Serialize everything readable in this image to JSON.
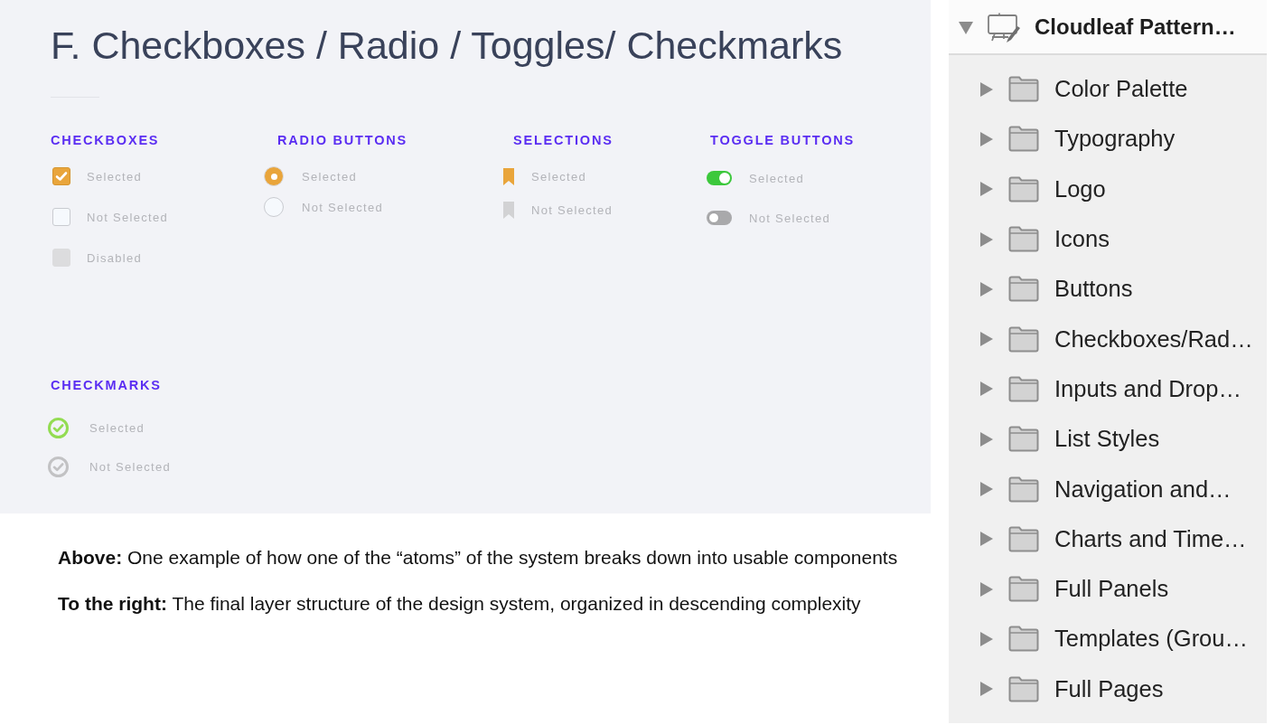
{
  "title": "F. Checkboxes / Radio / Toggles/ Checkmarks",
  "sections": [
    {
      "heading": "CHECKBOXES",
      "kind": "checkbox",
      "items": [
        {
          "label": "Selected",
          "checked": true,
          "disabled": false
        },
        {
          "label": "Not Selected",
          "checked": false,
          "disabled": false
        },
        {
          "label": "Disabled",
          "checked": false,
          "disabled": true
        }
      ]
    },
    {
      "heading": "RADIO BUTTONS",
      "kind": "radio",
      "items": [
        {
          "label": "Selected",
          "selected": true
        },
        {
          "label": "Not Selected",
          "selected": false
        }
      ]
    },
    {
      "heading": "SELECTIONS",
      "kind": "bookmark",
      "items": [
        {
          "label": "Selected",
          "selected": true
        },
        {
          "label": "Not Selected",
          "selected": false
        }
      ]
    },
    {
      "heading": "TOGGLE BUTTONS",
      "kind": "toggle",
      "items": [
        {
          "label": "Selected",
          "on": true
        },
        {
          "label": "Not Selected",
          "on": false
        }
      ]
    },
    {
      "heading": "CHECKMARKS",
      "kind": "checkmark",
      "items": [
        {
          "label": "Selected",
          "checked": true
        },
        {
          "label": "Not Selected",
          "checked": false
        }
      ]
    }
  ],
  "caption": [
    "**Above:** One example of how one of the “atoms” of the system breaks down into usable components",
    "**To the right:** The final layer structure of the design system, organized in descending complexity"
  ],
  "layers": [
    {
      "label": "Cloudleaf Pattern…",
      "expanded": true,
      "children": [
        {
          "label": "Color Palette",
          "expanded": false
        },
        {
          "label": "Typography",
          "expanded": false
        },
        {
          "label": "Logo",
          "expanded": false
        },
        {
          "label": "Icons",
          "expanded": false
        },
        {
          "label": "Buttons",
          "expanded": false
        },
        {
          "label": "Checkboxes/Rad…",
          "expanded": false
        },
        {
          "label": "Inputs and Drop…",
          "expanded": false
        },
        {
          "label": "List Styles",
          "expanded": false
        },
        {
          "label": "Navigation and…",
          "expanded": false
        },
        {
          "label": "Charts and Time…",
          "expanded": false
        },
        {
          "label": "Full Panels",
          "expanded": false
        },
        {
          "label": "Templates (Grou…",
          "expanded": false
        },
        {
          "label": "Full Pages",
          "expanded": false
        }
      ]
    }
  ]
}
